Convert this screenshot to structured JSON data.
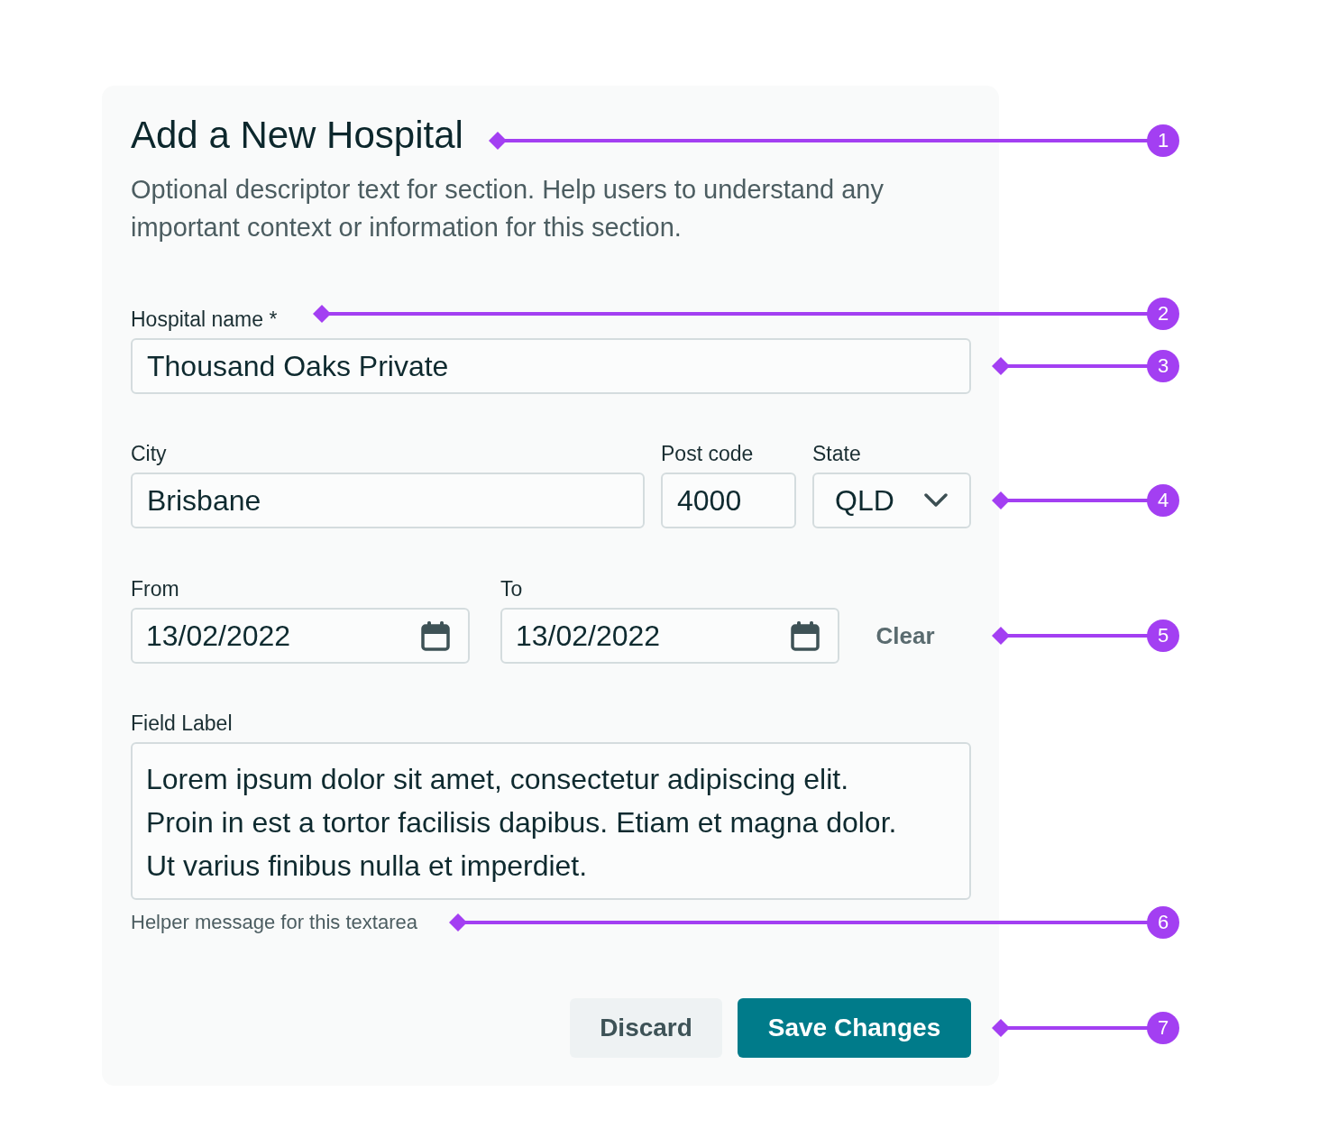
{
  "form": {
    "title": "Add a New Hospital",
    "description": "Optional descriptor text for section. Help users to understand any important context or information for this section."
  },
  "hospital_name": {
    "label": "Hospital name *",
    "value": "Thousand Oaks Private"
  },
  "address": [
    {
      "kind": "text",
      "label": "City",
      "value": "Brisbane"
    },
    {
      "kind": "text",
      "label": "Post code",
      "value": "4000"
    },
    {
      "kind": "select",
      "label": "State",
      "value": "QLD"
    }
  ],
  "date_range": {
    "fields": [
      {
        "label": "From",
        "value": "13/02/2022"
      },
      {
        "label": "To",
        "value": "13/02/2022"
      }
    ],
    "clear": "Clear"
  },
  "notes": {
    "label": "Field Label",
    "value": "Lorem ipsum dolor sit amet, consectetur adipiscing elit. Proin in est a tortor facilisis dapibus. Etiam et magna dolor. Ut varius finibus nulla et imperdiet.",
    "helper": "Helper message for this textarea"
  },
  "buttons": [
    {
      "kind": "secondary",
      "label": "Discard"
    },
    {
      "kind": "primary",
      "label": "Save Changes"
    }
  ],
  "annotations": [
    "1",
    "2",
    "3",
    "4",
    "5",
    "6",
    "7"
  ]
}
